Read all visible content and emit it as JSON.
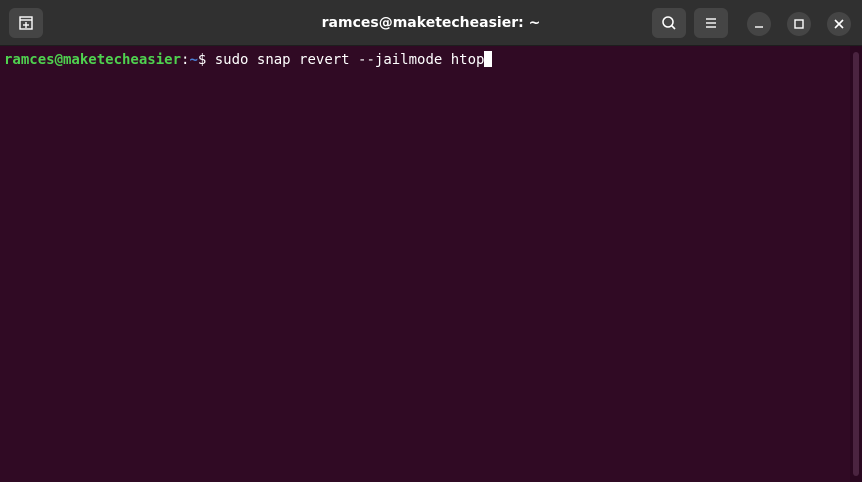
{
  "window": {
    "title": "ramces@maketecheasier: ~"
  },
  "titlebar": {
    "new_tab_icon": "new-tab-icon",
    "search_icon": "search-icon",
    "menu_icon": "hamburger-menu-icon",
    "minimize_icon": "minimize-icon",
    "maximize_icon": "maximize-icon",
    "close_icon": "close-icon"
  },
  "terminal": {
    "prompt_user": "ramces@maketecheasier",
    "prompt_sep": ":",
    "prompt_path": "~",
    "prompt_symbol": "$ ",
    "command": "sudo snap revert --jailmode htop"
  },
  "colors": {
    "background": "#300a24",
    "titlebar": "#303030",
    "prompt_user": "#4fd14f",
    "prompt_path": "#4a7fd6"
  }
}
